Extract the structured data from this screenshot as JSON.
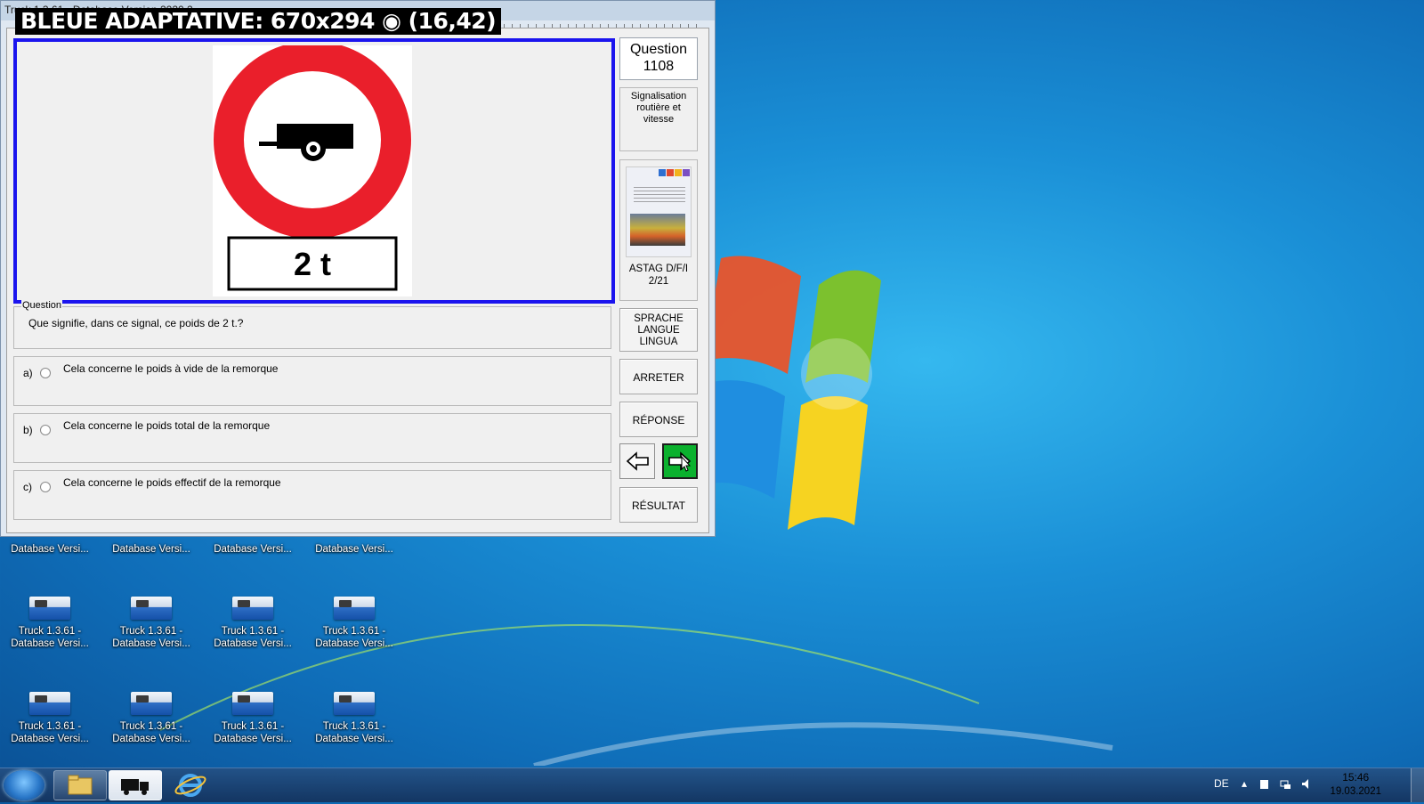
{
  "window": {
    "title": "Truck 1.3.61 - Database Version 2020.2",
    "overlay_label": "BLEUE ADAPTATIVE: 670x294 ◉ (16,42)"
  },
  "sign": {
    "weight_text": "2 t",
    "colors": {
      "ring": "#ea1f2b",
      "border": "#1b14ee"
    }
  },
  "sidebar": {
    "question_title": "Question",
    "question_number": "1108",
    "category_line1": "Signalisation",
    "category_line2": "routière et vitesse",
    "book_label_line1": "ASTAG D/F/I",
    "book_label_line2": "2/21",
    "book_tabs": "C CE D DE"
  },
  "question": {
    "legend": "Question",
    "text": "Que signifie, dans ce signal, ce poids de 2 t.?"
  },
  "answers": [
    {
      "letter": "a)",
      "text": "Cela concerne le poids à vide de la remorque"
    },
    {
      "letter": "b)",
      "text": "Cela concerne le poids total de la remorque"
    },
    {
      "letter": "c)",
      "text": "Cela concerne le poids effectif de la remorque"
    }
  ],
  "buttons": {
    "language_line1": "SPRACHE",
    "language_line2": "LANGUE",
    "language_line3": "LINGUA",
    "stop": "ARRETER",
    "answer": "RÉPONSE",
    "result": "RÉSULTAT",
    "next_color": "#0bb12e"
  },
  "desktop": {
    "partial_row_label": "Database Versi...",
    "icons": [
      {
        "line1": "Truck 1.3.61 -",
        "line2": "Database Versi..."
      },
      {
        "line1": "Truck 1.3.61 -",
        "line2": "Database Versi..."
      },
      {
        "line1": "Truck 1.3.61 -",
        "line2": "Database Versi..."
      },
      {
        "line1": "Truck 1.3.61 -",
        "line2": "Database Versi..."
      },
      {
        "line1": "Truck 1.3.61 -",
        "line2": "Database Versi..."
      },
      {
        "line1": "Truck 1.3.61 -",
        "line2": "Database Versi..."
      },
      {
        "line1": "Truck 1.3.61 -",
        "line2": "Database Versi..."
      },
      {
        "line1": "Truck 1.3.61 -",
        "line2": "Database Versi..."
      }
    ]
  },
  "taskbar": {
    "language": "DE",
    "time": "15:46",
    "date": "19.03.2021",
    "items": [
      "start-orb-icon",
      "file-explorer-icon",
      "truck-app-icon",
      "internet-explorer-icon"
    ]
  }
}
